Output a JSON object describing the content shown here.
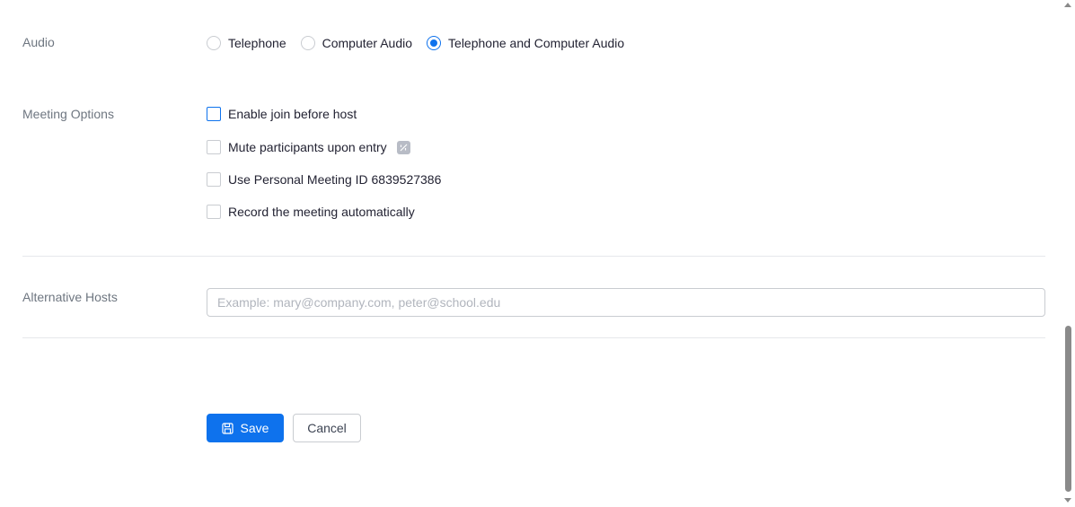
{
  "audio": {
    "label": "Audio",
    "options": [
      {
        "label": "Telephone",
        "checked": false
      },
      {
        "label": "Computer Audio",
        "checked": false
      },
      {
        "label": "Telephone and Computer Audio",
        "checked": true
      }
    ]
  },
  "meeting_options": {
    "label": "Meeting Options",
    "items": [
      {
        "label": "Enable join before host",
        "checked": false
      },
      {
        "label": "Mute participants upon entry",
        "checked": false
      },
      {
        "label": "Use Personal Meeting ID 6839527386",
        "checked": false
      },
      {
        "label": "Record the meeting automatically",
        "checked": false
      }
    ],
    "info_badge_icon": "info-icon"
  },
  "alternative_hosts": {
    "label": "Alternative Hosts",
    "value": "",
    "placeholder": "Example: mary@company.com, peter@school.edu"
  },
  "actions": {
    "save_label": "Save",
    "save_icon": "save-icon",
    "cancel_label": "Cancel"
  },
  "colors": {
    "accent": "#0e72ed",
    "label": "#6e7680",
    "text": "#232333"
  }
}
